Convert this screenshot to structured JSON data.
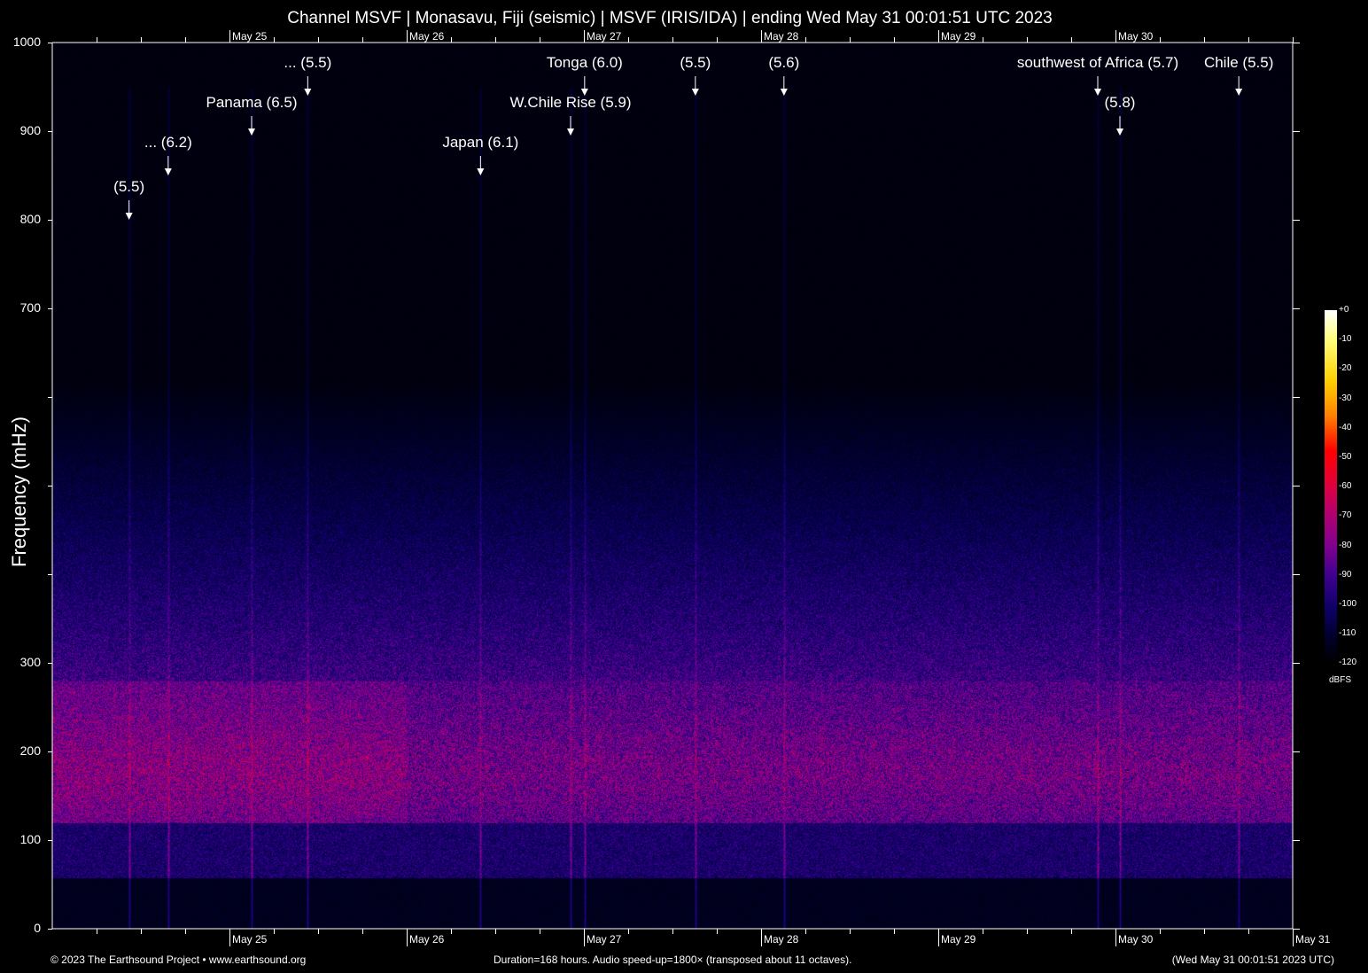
{
  "title": "Channel MSVF | Monasavu, Fiji (seismic) | MSVF (IRIS/IDA) | ending Wed May 31 00:01:51 UTC 2023",
  "footer": {
    "left": "© 2023 The Earthsound Project • www.earthsound.org",
    "center": "Duration=168 hours. Audio speed-up=1800× (transposed about 11 octaves).",
    "right": "(Wed May 31 00:01:51 2023 UTC)"
  },
  "chart_data": {
    "type": "heatmap",
    "title": "Channel MSVF | Monasavu, Fiji (seismic) | MSVF (IRIS/IDA) | ending Wed May 31 00:01:51 UTC 2023",
    "xlabel": "",
    "ylabel": "Frequency (mHz)",
    "xlim_hours": [
      0,
      168
    ],
    "ylim": [
      0,
      1000
    ],
    "x_ticks": [
      {
        "label": "May 25",
        "hour": 24
      },
      {
        "label": "May 26",
        "hour": 48
      },
      {
        "label": "May 27",
        "hour": 72
      },
      {
        "label": "May 28",
        "hour": 96
      },
      {
        "label": "May 29",
        "hour": 120
      },
      {
        "label": "May 30",
        "hour": 144
      },
      {
        "label": "May 31",
        "hour": 168
      }
    ],
    "y_tick_labels": [
      {
        "label": "0",
        "value": 0
      },
      {
        "label": "100",
        "value": 100
      },
      {
        "label": "200",
        "value": 200
      },
      {
        "label": "300",
        "value": 300
      },
      {
        "label": "700",
        "value": 700
      },
      {
        "label": "800",
        "value": 800
      },
      {
        "label": "900",
        "value": 900
      },
      {
        "label": "1000",
        "value": 1000
      }
    ],
    "colorbar": {
      "label": "dBFS",
      "ticks": [
        "+0",
        "-10",
        "-20",
        "-30",
        "-40",
        "-50",
        "-60",
        "-70",
        "-80",
        "-90",
        "-100",
        "-110",
        "-120"
      ],
      "range": [
        -120,
        0
      ]
    },
    "events": [
      {
        "label": "(5.5)",
        "hour": 10.4,
        "freq": 800
      },
      {
        "label": "... (6.2)",
        "hour": 15.7,
        "freq": 850
      },
      {
        "label": "Panama (6.5)",
        "hour": 27,
        "freq": 895
      },
      {
        "label": "... (5.5)",
        "hour": 34.6,
        "freq": 940
      },
      {
        "label": "Japan (6.1)",
        "hour": 58,
        "freq": 850
      },
      {
        "label": "W.Chile Rise (5.9)",
        "hour": 70.2,
        "freq": 895
      },
      {
        "label": "Tonga (6.0)",
        "hour": 72.1,
        "freq": 940
      },
      {
        "label": "(5.5)",
        "hour": 87.1,
        "freq": 940
      },
      {
        "label": "(5.6)",
        "hour": 99.1,
        "freq": 940
      },
      {
        "label": "southwest of Africa (5.7)",
        "hour": 141.6,
        "freq": 940
      },
      {
        "label": "(5.8)",
        "hour": 144.6,
        "freq": 895
      },
      {
        "label": "Chile (5.5)",
        "hour": 160.7,
        "freq": 940
      }
    ]
  }
}
